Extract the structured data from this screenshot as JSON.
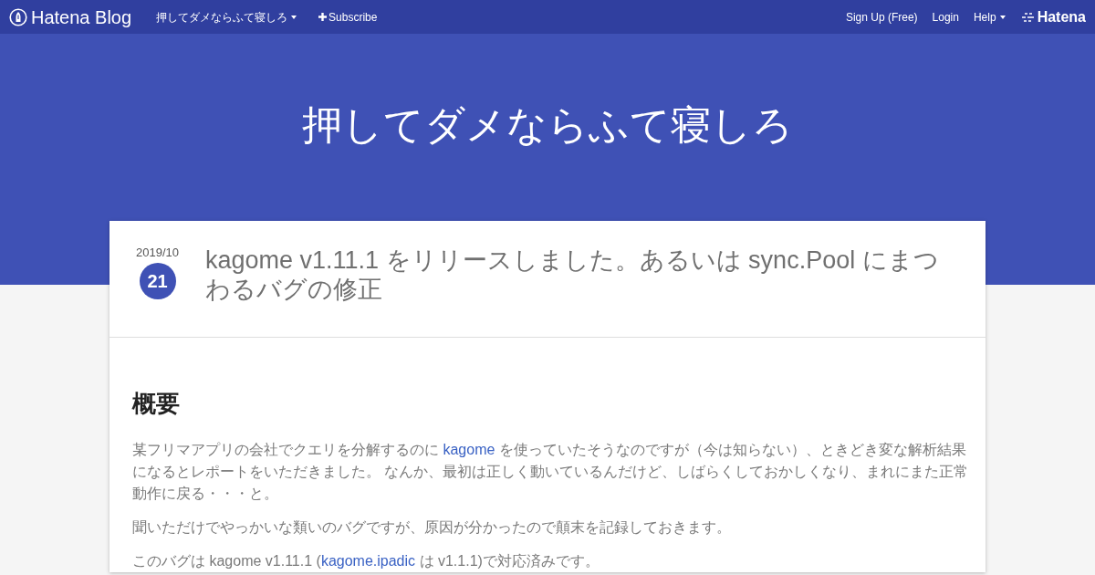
{
  "nav": {
    "logo": "Hatena Blog",
    "blog_menu": "押してダメならふて寝しろ",
    "subscribe": "Subscribe",
    "right": [
      {
        "kind": "link",
        "label": "Sign Up (Free)"
      },
      {
        "kind": "link",
        "label": "Login"
      },
      {
        "kind": "menu",
        "label": "Help"
      }
    ],
    "brand": "Hatena"
  },
  "header": {
    "title": "押してダメならふて寝しろ"
  },
  "entry": {
    "date": {
      "year_month": "2019/10",
      "day": "21"
    },
    "title": "kagome v1.11.1 をリリースしました。あるいは sync.Pool にまつわるバグの修正",
    "heading": "概要",
    "paragraphs": [
      [
        {
          "kind": "text",
          "text": "某フリマアプリの会社でクエリを分解するのに "
        },
        {
          "kind": "link",
          "text": "kagome"
        },
        {
          "kind": "text",
          "text": " を使っていたそうなのですが（今は知らない）、ときどき変な解析結果になるとレポートをいただきました。 なんか、最初は正しく動いているんだけど、しばらくしておかしくなり、まれにまた正常動作に戻る・・・と。"
        }
      ],
      [
        {
          "kind": "text",
          "text": "聞いただけでやっかいな類いのバグですが、原因が分かったので顛末を記録しておきます。"
        }
      ],
      [
        {
          "kind": "text",
          "text": "このバグは kagome v1.11.1 ("
        },
        {
          "kind": "link",
          "text": "kagome.ipadic"
        },
        {
          "kind": "text",
          "text": " は v1.1.1)で対応済みです。"
        }
      ]
    ]
  }
}
